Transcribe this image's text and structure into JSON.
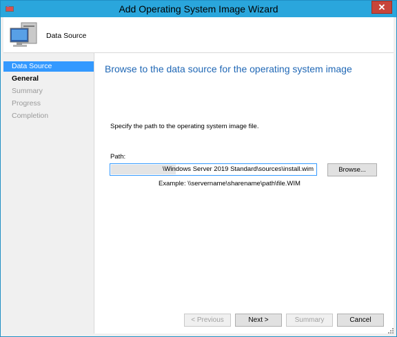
{
  "window": {
    "title": "Add Operating System Image Wizard",
    "close_symbol": "✕"
  },
  "header": {
    "step_title": "Data Source",
    "icon": "computer-icon"
  },
  "nav": {
    "items": [
      {
        "label": "Data Source",
        "state": "active"
      },
      {
        "label": "General",
        "state": "current"
      },
      {
        "label": "Summary",
        "state": "inactive"
      },
      {
        "label": "Progress",
        "state": "inactive"
      },
      {
        "label": "Completion",
        "state": "inactive"
      }
    ]
  },
  "content": {
    "heading": "Browse to the data source for the operating system image",
    "instruction": "Specify the path to the operating system image file.",
    "path_label": "Path:",
    "path_value": "\\Windows Server 2019 Standard\\sources\\install.wim",
    "browse_label": "Browse...",
    "example": "Example: \\\\servername\\sharename\\path\\file.WIM"
  },
  "footer": {
    "previous_label": "< Previous",
    "next_label": "Next >",
    "summary_label": "Summary",
    "cancel_label": "Cancel"
  },
  "colors": {
    "titlebar": "#2aa6dc",
    "accent": "#3399ff",
    "heading": "#1f67b5",
    "close": "#c7453a"
  }
}
